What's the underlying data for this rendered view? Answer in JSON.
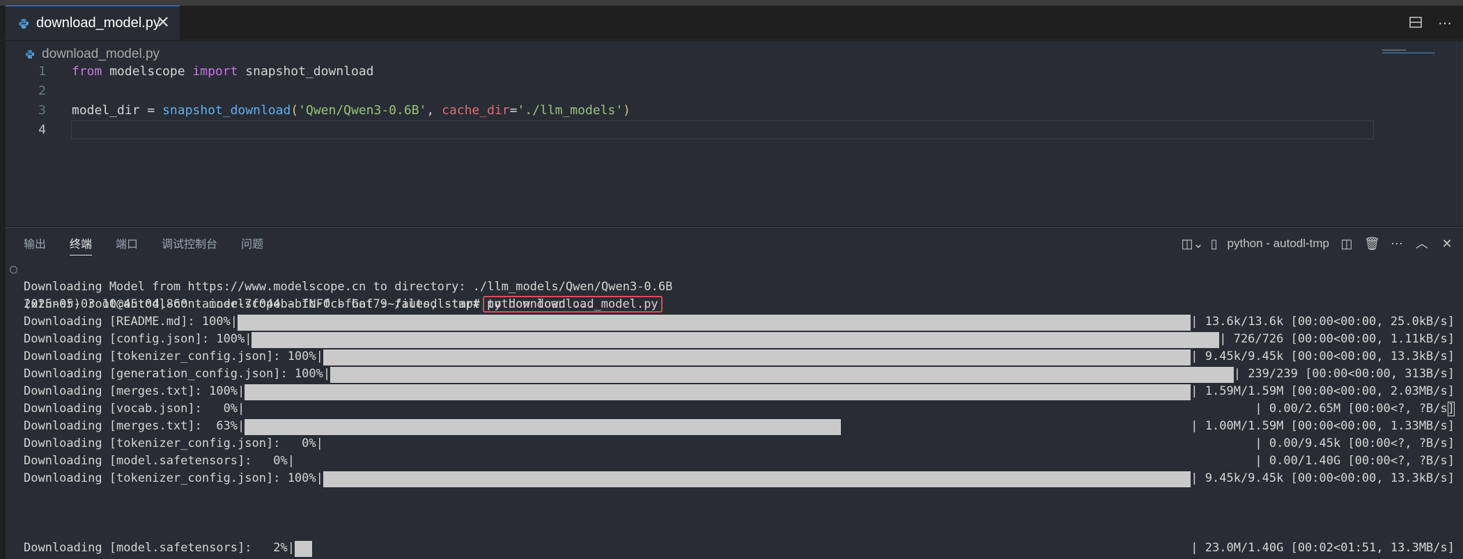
{
  "tab": {
    "filename": "download_model.py",
    "close": "✕"
  },
  "breadcrumb": {
    "file": "download_model.py"
  },
  "editor": {
    "lines": [
      {
        "num": "1",
        "tokens": [
          {
            "t": "from",
            "c": "kw"
          },
          {
            "t": " modelscope ",
            "c": ""
          },
          {
            "t": "import",
            "c": "kw"
          },
          {
            "t": " snapshot_download",
            "c": ""
          }
        ]
      },
      {
        "num": "2",
        "tokens": []
      },
      {
        "num": "3",
        "tokens": [
          {
            "t": "model_dir",
            "c": ""
          },
          {
            "t": " = ",
            "c": ""
          },
          {
            "t": "snapshot_download",
            "c": "fn"
          },
          {
            "t": "(",
            "c": "pa"
          },
          {
            "t": "'Qwen/Qwen3-0.6B'",
            "c": "st"
          },
          {
            "t": ", ",
            "c": ""
          },
          {
            "t": "cache_dir",
            "c": "var"
          },
          {
            "t": "=",
            "c": ""
          },
          {
            "t": "'./llm_models'",
            "c": "st"
          },
          {
            "t": ")",
            "c": "pa"
          }
        ]
      },
      {
        "num": "4",
        "tokens": []
      }
    ],
    "current_line": "4"
  },
  "panel": {
    "tabs": [
      "输出",
      "终端",
      "端口",
      "调试控制台",
      "问题"
    ],
    "active_tab": "终端",
    "terminal_name": "python - autodl-tmp"
  },
  "terminal": {
    "prompt": "(xtuner) root@autodl-container-7f044babfc-fcbfbaf7:~/autodl-tmp#",
    "command": "python download_model.py",
    "lines": [
      {
        "left": "Downloading Model from https://www.modelscope.cn to directory: ./llm_models/Qwen/Qwen3-0.6B",
        "right": "",
        "progress": null
      },
      {
        "left": "2025-05-03 10:45:04,860 - modelscope - INFO - Got 9 files, start to download ...",
        "right": "",
        "progress": null
      },
      {
        "left": "Downloading [README.md]: 100%|",
        "right": "| 13.6k/13.6k [00:00<00:00, 25.0kB/s]",
        "progress": 1.0
      },
      {
        "left": "Downloading [config.json]: 100%|",
        "right": "| 726/726 [00:00<00:00, 1.11kB/s]",
        "progress": 1.0
      },
      {
        "left": "Downloading [tokenizer_config.json]: 100%|",
        "right": "| 9.45k/9.45k [00:00<00:00, 13.3kB/s]",
        "progress": 1.0
      },
      {
        "left": "Downloading [generation_config.json]: 100%|",
        "right": "| 239/239 [00:00<00:00, 313B/s]",
        "progress": 1.0
      },
      {
        "left": "Downloading [merges.txt]: 100%|",
        "right": "| 1.59M/1.59M [00:00<00:00, 2.03MB/s]",
        "progress": 1.0
      },
      {
        "left": "Downloading [vocab.json]:   0%|",
        "right": "| 0.00/2.65M [00:00<?, ?B/s]",
        "progress": 0
      },
      {
        "left": "Downloading [merges.txt]:  63%|",
        "right": "| 1.00M/1.59M [00:00<00:00, 1.33MB/s]",
        "progress": 0.63
      },
      {
        "left": "Downloading [tokenizer_config.json]:   0%|",
        "right": "| 0.00/9.45k [00:00<?, ?B/s]",
        "progress": 0
      },
      {
        "left": "Downloading [model.safetensors]:   0%|",
        "right": "| 0.00/1.40G [00:00<?, ?B/s]",
        "progress": 0
      },
      {
        "left": "Downloading [tokenizer_config.json]: 100%|",
        "right": "| 9.45k/9.45k [00:00<00:00, 13.3kB/s]",
        "progress": 1.0
      },
      {
        "left": "",
        "right": "",
        "progress": null
      },
      {
        "left": "",
        "right": "",
        "progress": null
      },
      {
        "left": "",
        "right": "",
        "progress": null
      },
      {
        "left": "Downloading [model.safetensors]:   2%|",
        "right": "| 23.0M/1.40G [00:02<01:51, 13.3MB/s]",
        "progress": 0.02
      }
    ]
  },
  "icons": {
    "python": "python-icon",
    "split": "split-editor-icon",
    "more": "more-actions-icon",
    "close": "close-icon"
  },
  "colors": {
    "accent": "#3794ff",
    "highlight_box": "#e04c5c",
    "progress_fill": "#cacaca"
  }
}
